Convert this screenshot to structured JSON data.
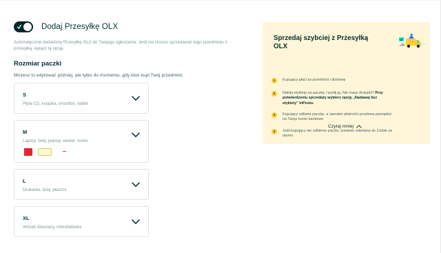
{
  "toggle": {
    "label": "Dodaj Przesyłkę OLX",
    "state": "on"
  },
  "description": "Automatycznie dodaliśmy Przesyłkę OLX do Twojego ogłoszenia. Jeśli nie chcesz sprzedawać tego przedmiotu z przesyłką, wyłącz tę opcję.",
  "package_size": {
    "title": "Rozmiar paczki",
    "subtitle": "Możesz to edytować później, ale tylko do momentu, gdy ktoś kupi Twój przedmiot.",
    "options": [
      {
        "size": "S",
        "description": "Płyta CD, książka, smartfon, tablet"
      },
      {
        "size": "M",
        "description": "Laptop, buty, jeansy, sweter, toster",
        "carriers": [
          "ORLEN",
          "InPost",
          "Poczta Polska"
        ]
      },
      {
        "size": "L",
        "description": "Drukarka, buty, płaszcz"
      },
      {
        "size": "XL",
        "description": "Wózek dziecięcy, mikrofalówka"
      }
    ]
  },
  "info_card": {
    "title": "Sprzedaj szybciej z Przesyłką OLX",
    "steps": [
      {
        "number": "1",
        "text": "Kupujący płaci za przedmiot i dostawę"
      },
      {
        "number": "2",
        "text_plain": "Naklej etykietę na paczkę i wyślij ją. Nie masz drukarki? ",
        "text_bold": "Przy potwierdzeniu sprzedaży wybierz opcję „Nadawaj bez etykiety” InPostu."
      },
      {
        "number": "3",
        "text": "Kupujący odbiera paczkę, a operator płatności przelewa pieniądze na Twoje konto bankowe"
      },
      {
        "number": "4",
        "text": "Jeśli kupujący nie odbierze paczki, zostanie odesłana do Ciebie za darmo"
      }
    ],
    "read_less": "Czytaj mniej"
  },
  "colors": {
    "primary_text": "#002f34",
    "muted_text": "#7f9799",
    "toggle_bg": "#02282c",
    "info_bg": "#fff6d9",
    "step_badge": "#ffce32"
  },
  "icons": {
    "toggle": "toggle-on-icon",
    "size_option_expand": "chevron-down-icon",
    "read_less": "chevron-up-icon",
    "illustration": "delivery-truck-icon"
  }
}
